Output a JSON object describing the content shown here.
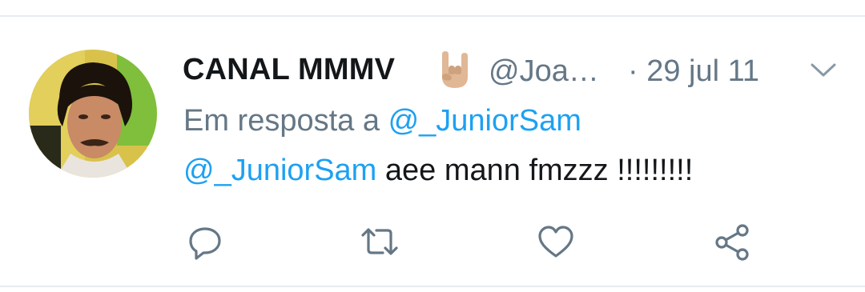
{
  "tweet": {
    "display_name": "CANAL MMMV",
    "emoji_icon": "sign-of-the-horns-emoji",
    "handle": "@Joa…",
    "date": "· 29 jul 11",
    "reply_prefix": "Em resposta a",
    "reply_to": "@_JuniorSam",
    "text_mention": "@_JuniorSam",
    "text_body": " aee mann fmzzz !!!!!!!!!"
  },
  "actions": [
    {
      "icon": "reply-icon"
    },
    {
      "icon": "retweet-icon"
    },
    {
      "icon": "like-icon"
    },
    {
      "icon": "share-icon"
    }
  ],
  "colors": {
    "text_primary": "#14171a",
    "text_secondary": "#657786",
    "link": "#1da1f2",
    "divider": "#e6ecf0"
  }
}
